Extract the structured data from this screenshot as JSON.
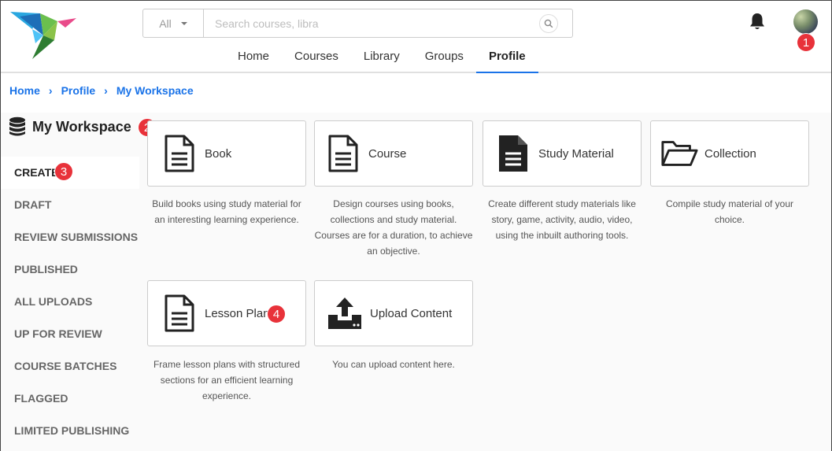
{
  "header": {
    "search": {
      "filter": "All",
      "placeholder": "Search courses, libra"
    },
    "nav": [
      {
        "label": "Home"
      },
      {
        "label": "Courses"
      },
      {
        "label": "Library"
      },
      {
        "label": "Groups"
      },
      {
        "label": "Profile",
        "active": true
      }
    ]
  },
  "breadcrumb": [
    "Home",
    "Profile",
    "My Workspace"
  ],
  "workspace": {
    "title": "My Workspace"
  },
  "sidebar": {
    "items": [
      {
        "label": "CREATE",
        "active": true
      },
      {
        "label": "DRAFT"
      },
      {
        "label": "REVIEW SUBMISSIONS"
      },
      {
        "label": "PUBLISHED"
      },
      {
        "label": "ALL UPLOADS"
      },
      {
        "label": "UP FOR REVIEW"
      },
      {
        "label": "COURSE BATCHES"
      },
      {
        "label": "FLAGGED"
      },
      {
        "label": "LIMITED PUBLISHING"
      }
    ]
  },
  "cards": [
    {
      "label": "Book",
      "icon": "document-icon",
      "desc": "Build books using study material for an interesting learning experience."
    },
    {
      "label": "Course",
      "icon": "document-icon",
      "desc": "Design courses using books, collections and study material. Courses are for a duration, to achieve an objective."
    },
    {
      "label": "Study Material",
      "icon": "filled-document-icon",
      "desc": "Create different study materials like story, game, activity, audio, video, using the inbuilt authoring tools."
    },
    {
      "label": "Collection",
      "icon": "folder-open-icon",
      "desc": "Compile study material of your choice."
    },
    {
      "label": "Lesson Plan",
      "icon": "document-icon",
      "desc": "Frame lesson plans with structured sections for an efficient learning experience."
    },
    {
      "label": "Upload Content",
      "icon": "upload-icon",
      "desc": "You can upload content here."
    }
  ],
  "annotations": [
    "1",
    "2",
    "3",
    "4"
  ],
  "colors": {
    "accent": "#1a73e8",
    "badge": "#e8323a"
  }
}
